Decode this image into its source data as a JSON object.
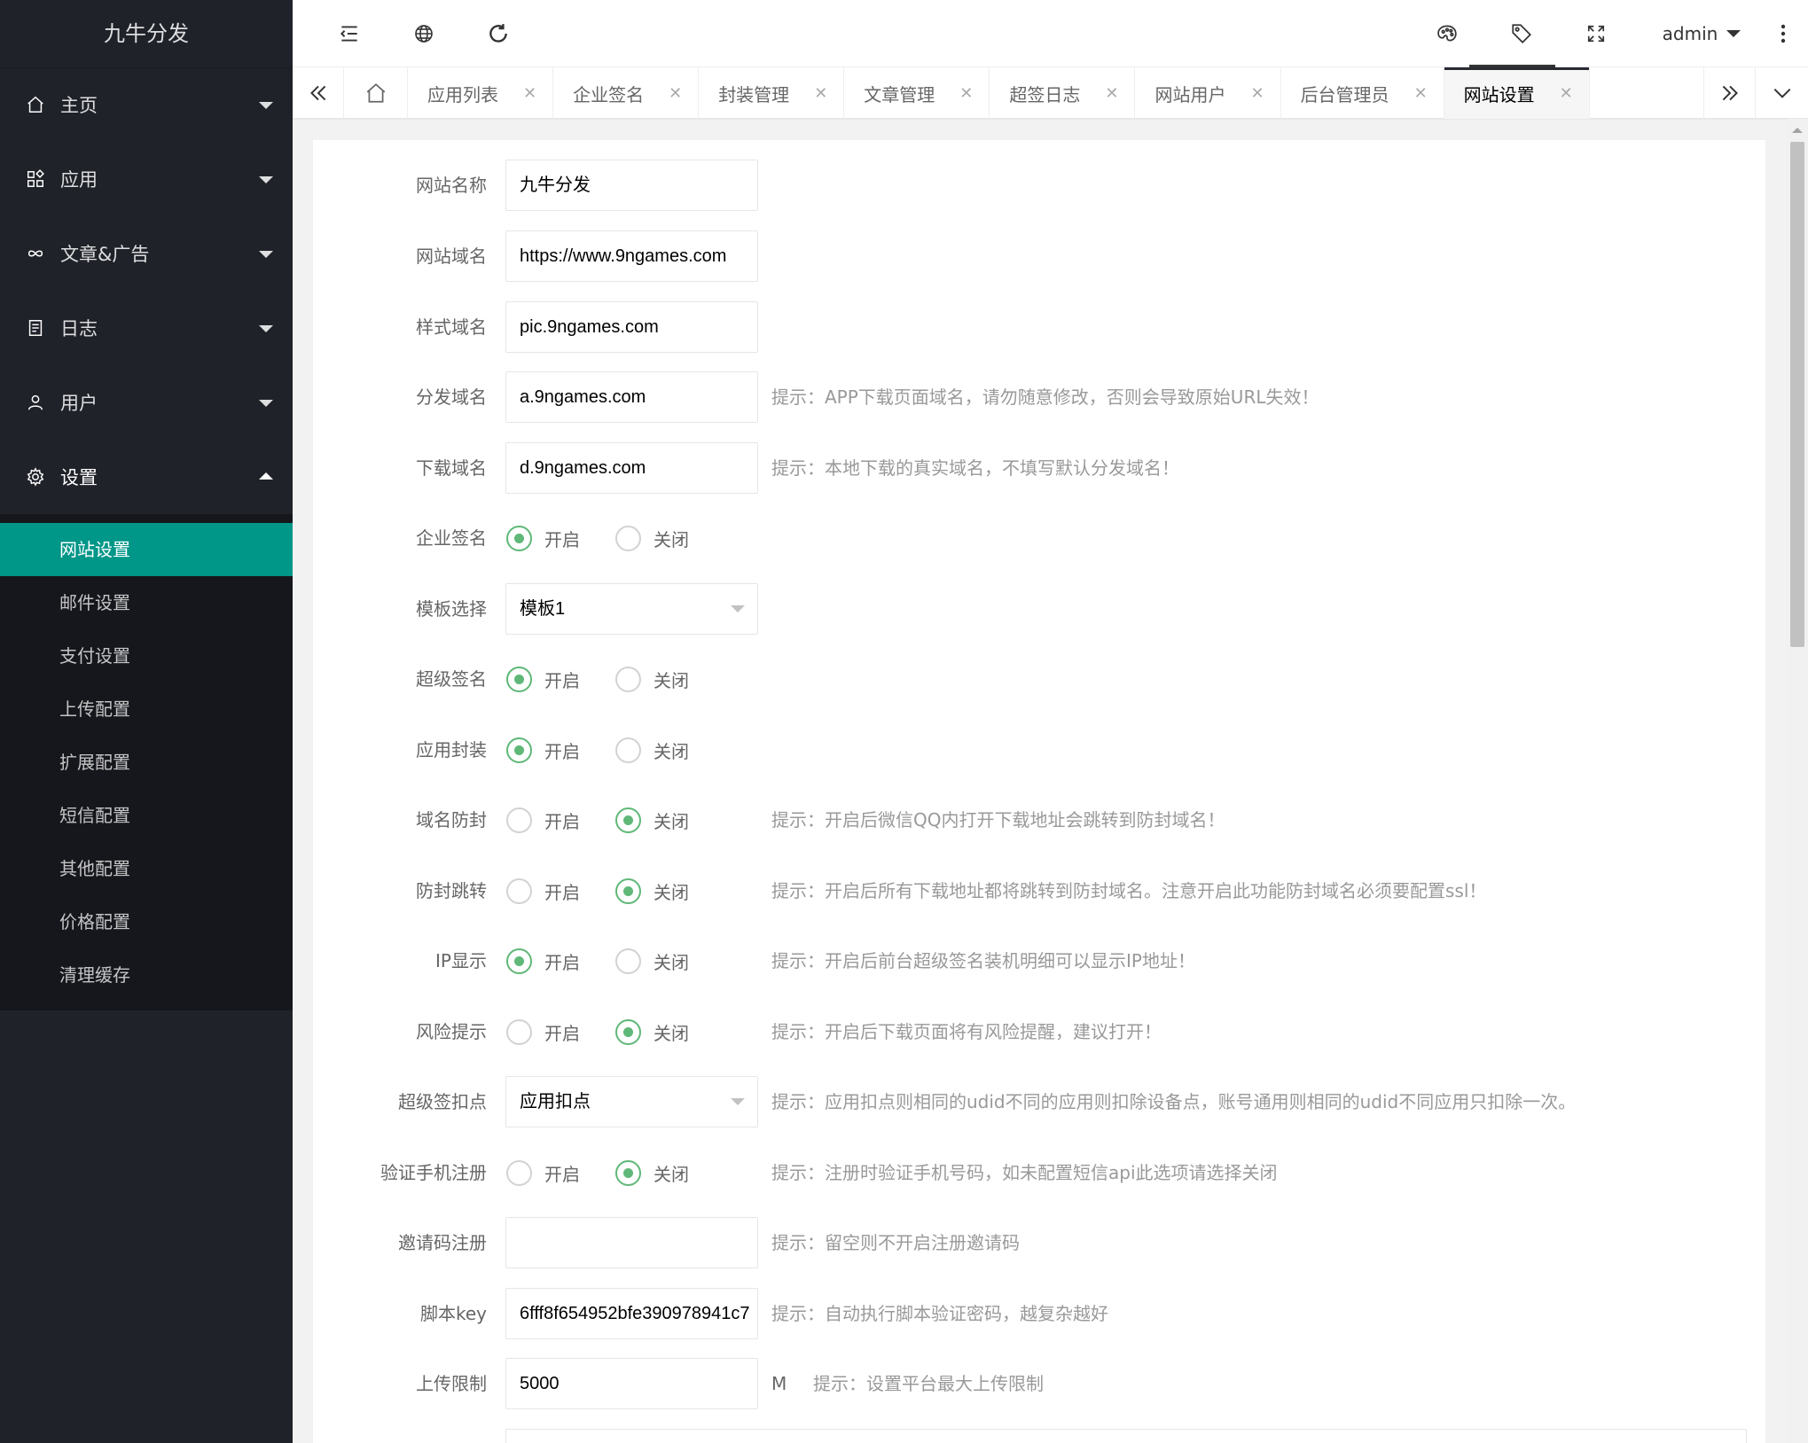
{
  "app": {
    "logo": "九牛分发"
  },
  "sidebar": {
    "items": [
      {
        "label": "主页",
        "icon": "home-icon"
      },
      {
        "label": "应用",
        "icon": "apps-icon"
      },
      {
        "label": "文章&广告",
        "icon": "infinity-icon"
      },
      {
        "label": "日志",
        "icon": "log-icon"
      },
      {
        "label": "用户",
        "icon": "user-icon"
      },
      {
        "label": "设置",
        "icon": "gear-icon"
      }
    ],
    "submenu": [
      "网站设置",
      "邮件设置",
      "支付设置",
      "上传配置",
      "扩展配置",
      "短信配置",
      "其他配置",
      "价格配置",
      "清理缓存"
    ],
    "active_sub": "网站设置"
  },
  "header": {
    "user": "admin"
  },
  "tabs": [
    {
      "label": "应用列表"
    },
    {
      "label": "企业签名"
    },
    {
      "label": "封装管理"
    },
    {
      "label": "文章管理"
    },
    {
      "label": "超签日志"
    },
    {
      "label": "网站用户"
    },
    {
      "label": "后台管理员"
    },
    {
      "label": "网站设置",
      "active": true
    }
  ],
  "radio_labels": {
    "on": "开启",
    "off": "关闭"
  },
  "form": {
    "site_name": {
      "label": "网站名称",
      "value": "九牛分发"
    },
    "site_domain": {
      "label": "网站域名",
      "value": "https://www.9ngames.com"
    },
    "style_domain": {
      "label": "样式域名",
      "value": "pic.9ngames.com"
    },
    "dist_domain": {
      "label": "分发域名",
      "value": "a.9ngames.com",
      "tip": "提示：APP下载页面域名，请勿随意修改，否则会导致原始URL失效！"
    },
    "download_domain": {
      "label": "下载域名",
      "value": "d.9ngames.com",
      "tip": "提示：本地下载的真实域名，不填写默认分发域名！"
    },
    "enterprise_sign": {
      "label": "企业签名",
      "value": "on"
    },
    "template": {
      "label": "模板选择",
      "value": "模板1"
    },
    "super_sign": {
      "label": "超级签名",
      "value": "on"
    },
    "app_wrap": {
      "label": "应用封装",
      "value": "on"
    },
    "domain_block": {
      "label": "域名防封",
      "value": "off",
      "tip": "提示：开启后微信QQ内打开下载地址会跳转到防封域名！"
    },
    "block_redirect": {
      "label": "防封跳转",
      "value": "off",
      "tip": "提示：开启后所有下载地址都将跳转到防封域名。注意开启此功能防封域名必须要配置ssl！"
    },
    "ip_display": {
      "label": "IP显示",
      "value": "on",
      "tip": "提示：开启后前台超级签名装机明细可以显示IP地址！"
    },
    "risk_tip": {
      "label": "风险提示",
      "value": "off",
      "tip": "提示：开启后下载页面将有风险提醒，建议打开！"
    },
    "super_deduct": {
      "label": "超级签扣点",
      "value": "应用扣点",
      "tip": "提示：应用扣点则相同的udid不同的应用则扣除设备点，账号通用则相同的udid不同应用只扣除一次。"
    },
    "phone_verify": {
      "label": "验证手机注册",
      "value": "off",
      "tip": "提示：注册时验证手机号码，如未配置短信api此选项请选择关闭"
    },
    "invite_code": {
      "label": "邀请码注册",
      "value": "",
      "tip": "提示：留空则不开启注册邀请码"
    },
    "script_key": {
      "label": "脚本key",
      "value": "6fff8f654952bfe390978941c7",
      "tip": "提示：自动执行脚本验证密码，越复杂越好"
    },
    "upload_limit": {
      "label": "上传限制",
      "value": "5000",
      "unit": "M",
      "tip": "提示：设置平台最大上传限制"
    }
  },
  "colors": {
    "sidebar": "#20222a",
    "submenu": "#16171c",
    "accent": "#009688",
    "radio": "#5fb878"
  }
}
